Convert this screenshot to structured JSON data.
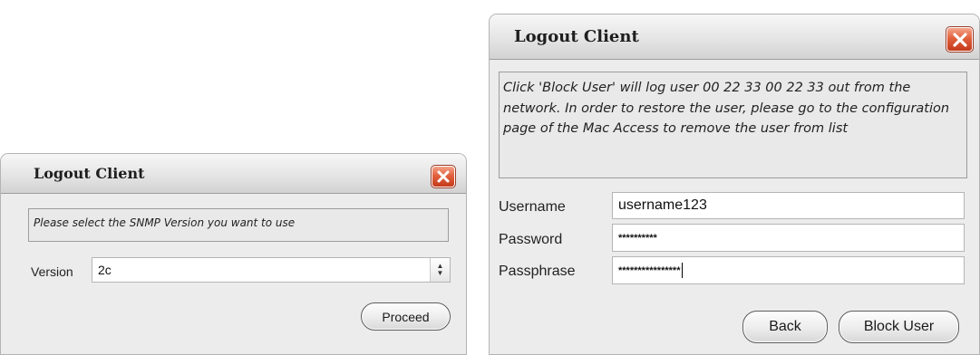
{
  "version_dialog": {
    "title": "Logout Client",
    "message": "Please select the SNMP Version you want to use",
    "version_label": "Version",
    "version_value": "2c",
    "proceed_label": "Proceed"
  },
  "block_dialog": {
    "title": "Logout Client",
    "message": "Click 'Block User' will log user 00 22 33 00 22 33 out from the network. In order to restore the user, please go to the configuration page of the Mac Access to remove the user from list",
    "username_label": "Username",
    "username_value": "username123",
    "password_label": "Password",
    "password_value": "**********",
    "passphrase_label": "Passphrase",
    "passphrase_value": "****************",
    "back_label": "Back",
    "block_user_label": "Block User"
  },
  "icons": {
    "close": "close-icon",
    "spinner": "spinner-arrows-icon"
  },
  "colors": {
    "close_button": "#d8502d",
    "dialog_background": "#ececec"
  }
}
